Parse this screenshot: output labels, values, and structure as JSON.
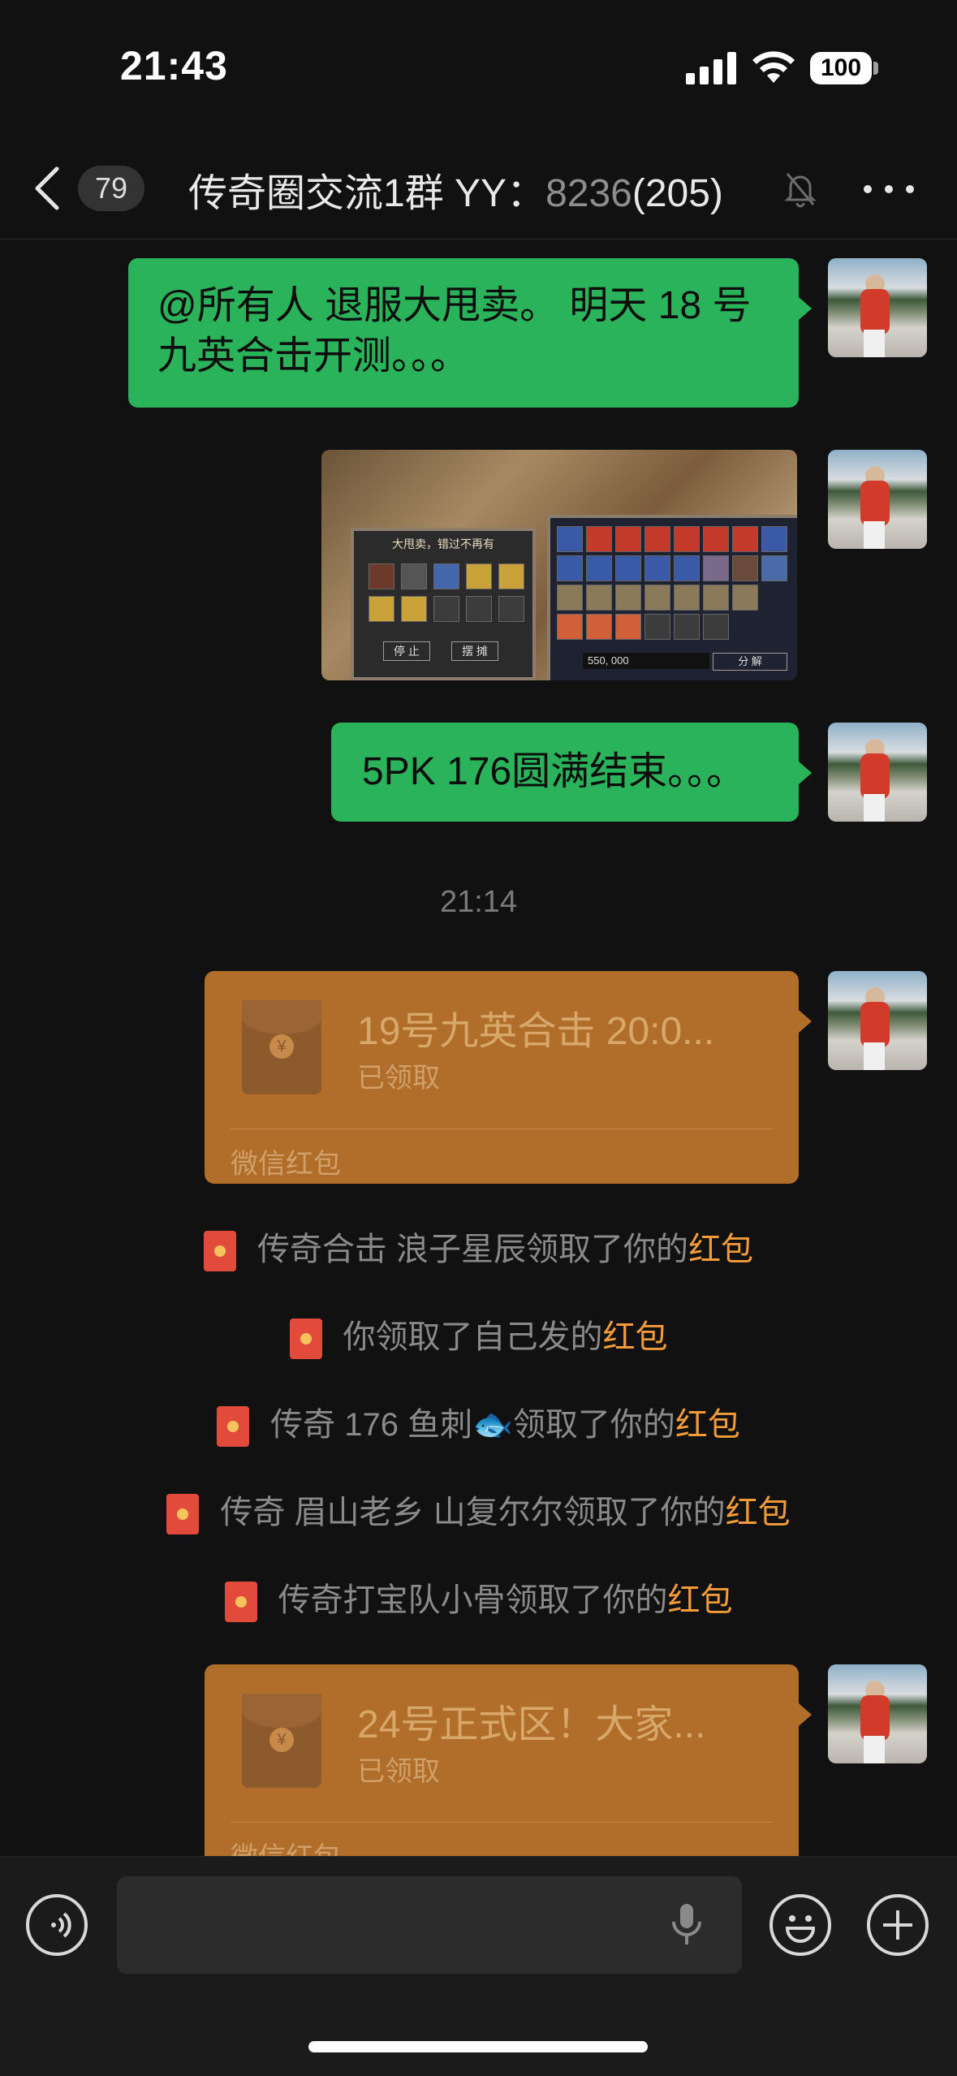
{
  "status_bar": {
    "time": "21:43",
    "battery": "100"
  },
  "nav": {
    "unread_count": "79",
    "title": "传奇圈交流1群 YY：",
    "title_id": "8236",
    "member_count": "(205)"
  },
  "messages": {
    "text_1": "@所有人 退服大甩卖。 明天 18 号九英合击开测。。。",
    "text_2": "5PK  176圆满结束。。。",
    "timestamp": "21:14",
    "packet_1": {
      "title": "19号九英合击 20:0...",
      "status": "已领取",
      "label": "微信红包"
    },
    "notices": [
      {
        "before": "传奇合击 浪子星辰领取了你的",
        "highlight": "红包"
      },
      {
        "before": "你领取了自己发的",
        "highlight": "红包"
      },
      {
        "before": "传奇 176 鱼刺🐟领取了你的",
        "highlight": "红包"
      },
      {
        "before": "传奇 眉山老乡 山复尔尔领取了你的",
        "highlight": "红包"
      },
      {
        "before": "传奇打宝队小骨领取了你的",
        "highlight": "红包"
      }
    ],
    "packet_2": {
      "title": "24号正式区！大家...",
      "status": "已领取",
      "label": "微信红包"
    }
  },
  "game_image": {
    "panel_title": "大甩卖，错过不再有",
    "btn_left": "停 止",
    "btn_right": "摆 摊",
    "gold": "550, 000",
    "btn_split": "分 解"
  },
  "colors": {
    "bubble_green": "#2ab35a",
    "packet_orange": "#b06e2a",
    "highlight": "#f29b38"
  }
}
